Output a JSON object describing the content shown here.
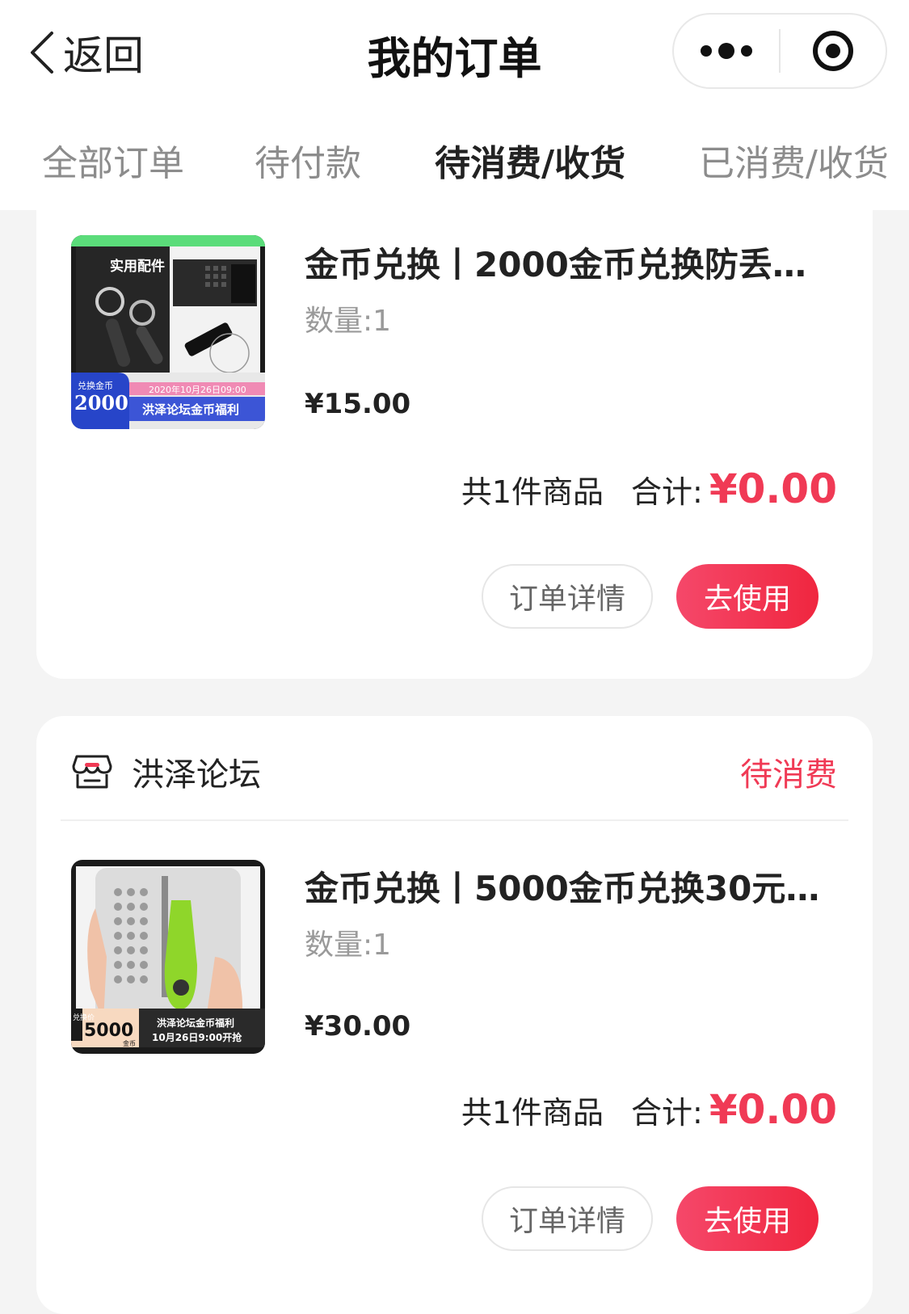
{
  "header": {
    "back_label": "返回",
    "title": "我的订单",
    "more_icon": "more-dots-icon",
    "target_icon": "target-icon"
  },
  "tabs": [
    {
      "label": "全部订单",
      "active": false
    },
    {
      "label": "待付款",
      "active": false
    },
    {
      "label": "待消费/收货",
      "active": true
    },
    {
      "label": "已消费/收货",
      "active": false
    }
  ],
  "orders": [
    {
      "item": {
        "title": "金币兑换丨2000金币兑换防丢钥...",
        "quantity": "数量:1",
        "price": "¥15.00",
        "image": {
          "badge_label": "兑换金币",
          "badge_value": "2000",
          "heading": "实用配件",
          "date_text": "2020年10月26日09:00",
          "banner_text": "洪泽论坛金币福利"
        }
      },
      "summary": {
        "count": "共1件商品",
        "total_label": "合计:",
        "total": "¥0.00"
      },
      "buttons": {
        "detail": "订单详情",
        "use": "去使用"
      }
    },
    {
      "shop": {
        "name": "洪泽论坛",
        "status": "待消费",
        "icon": "shop-icon"
      },
      "item": {
        "title": "金币兑换丨5000金币兑换30元多...",
        "quantity": "数量:1",
        "price": "¥30.00",
        "image": {
          "badge_side": "兑换价",
          "badge_value": "5000",
          "badge_unit": "金币",
          "banner_line1": "洪泽论坛金币福利",
          "banner_line2": "10月26日9:00开抢"
        }
      },
      "summary": {
        "count": "共1件商品",
        "total_label": "合计:",
        "total": "¥0.00"
      },
      "buttons": {
        "detail": "订单详情",
        "use": "去使用"
      }
    }
  ],
  "colors": {
    "accent": "#f03a55",
    "text": "#222222",
    "muted": "#8c8c8c"
  }
}
